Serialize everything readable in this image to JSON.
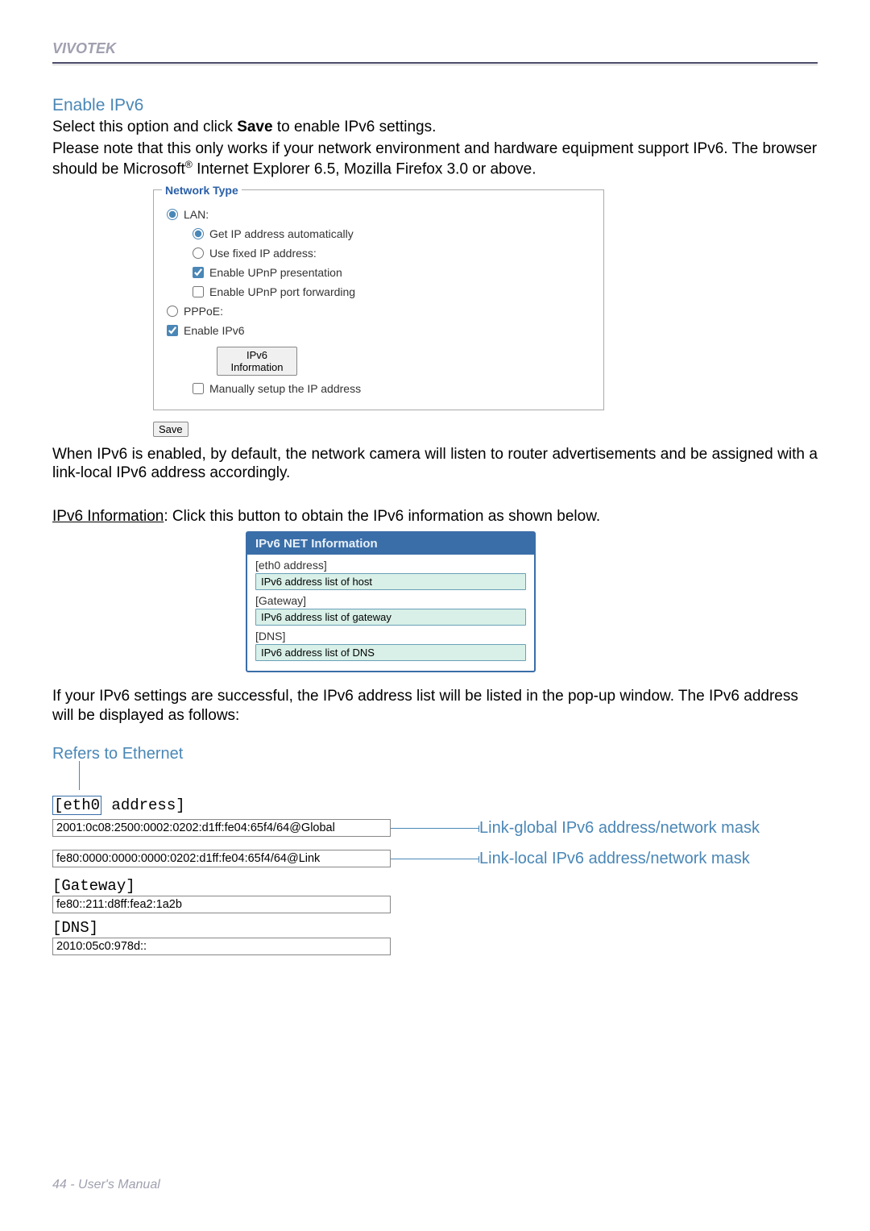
{
  "header": {
    "brand": "VIVOTEK"
  },
  "section": {
    "title": "Enable IPv6",
    "p1_a": "Select this option and click ",
    "p1_bold": "Save",
    "p1_b": " to enable IPv6 settings.",
    "p2_a": "Please note that this only works if your network environment and hardware equipment support IPv6. The browser should be Microsoft",
    "p2_sup": "®",
    "p2_b": " Internet Explorer 6.5, Mozilla Firefox 3.0 or above."
  },
  "network_type": {
    "legend": "Network Type",
    "lan": "LAN:",
    "get_ip": "Get IP address automatically",
    "fixed_ip": "Use fixed IP address:",
    "upnp_presentation": "Enable UPnP presentation",
    "upnp_port": "Enable UPnP port forwarding",
    "pppoe": "PPPoE:",
    "enable_ipv6": "Enable IPv6",
    "ipv6_info_btn": "IPv6 Information",
    "manual_ip": "Manually setup the IP address",
    "save_btn": "Save",
    "states": {
      "mode": "lan",
      "ip_mode": "auto",
      "upnp_presentation": true,
      "upnp_port": false,
      "enable_ipv6": true,
      "manual_ip": false
    }
  },
  "after_fieldset": {
    "p1": "When IPv6 is enabled, by default, the network camera will listen to router advertisements and be assigned with a link-local IPv6 address accordingly.",
    "p2_u": "IPv6 Information",
    "p2_rest": ": Click this button to obtain the IPv6 information as shown below."
  },
  "ipv6_panel": {
    "title": "IPv6 NET Information",
    "eth_label": "[eth0 address]",
    "eth_field": "IPv6 address list of host",
    "gw_label": "[Gateway]",
    "gw_field": "IPv6 address list of gateway",
    "dns_label": "[DNS]",
    "dns_field": "IPv6 address list of DNS"
  },
  "after_panel": {
    "p1": "If your IPv6 settings are successful, the IPv6 address list will be listed in the pop-up window. The IPv6 address will be displayed as follows:"
  },
  "ethernet": {
    "refers": "Refers to Ethernet",
    "eth0_a": "[eth0",
    "eth0_b": " address]",
    "addr_global": "2001:0c08:2500:0002:0202:d1ff:fe04:65f4/64@Global",
    "addr_link": "fe80:0000:0000:0000:0202:d1ff:fe04:65f4/64@Link",
    "gateway_label": "[Gateway]",
    "gateway_val": "fe80::211:d8ff:fea2:1a2b",
    "dns_label": "[DNS]",
    "dns_val": "2010:05c0:978d::",
    "callout_global": "Link-global IPv6 address/network mask",
    "callout_link": "Link-local IPv6 address/network mask"
  },
  "footer": {
    "text": "44 - User's Manual"
  }
}
